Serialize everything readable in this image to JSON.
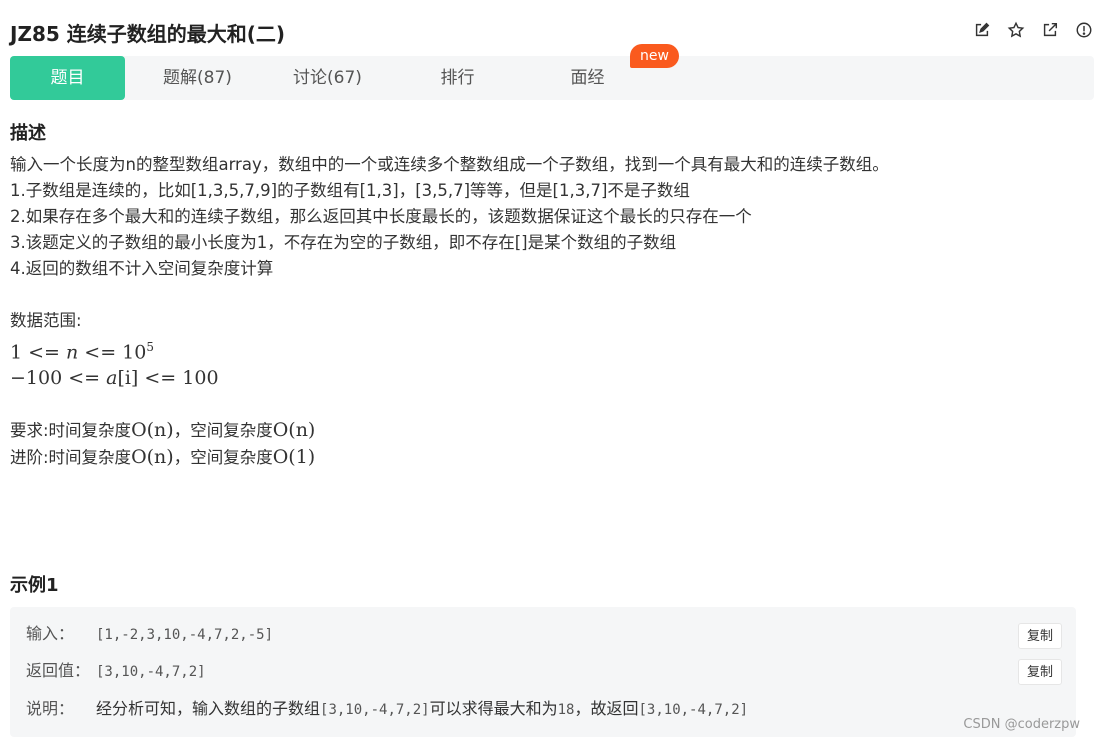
{
  "problem": {
    "title": "JZ85  连续子数组的最大和(二)"
  },
  "header_icons": [
    "edit-icon",
    "star-icon",
    "external-link-icon",
    "info-icon"
  ],
  "tabs": [
    {
      "label": "题目",
      "active": true
    },
    {
      "label": "题解(87)",
      "active": false
    },
    {
      "label": "讨论(67)",
      "active": false
    },
    {
      "label": "排行",
      "active": false
    },
    {
      "label": "面经",
      "active": false
    }
  ],
  "new_badge": "new",
  "description": {
    "heading": "描述",
    "lines": [
      "输入一个长度为n的整型数组array，数组中的一个或连续多个整数组成一个子数组，找到一个具有最大和的连续子数组。",
      "1.子数组是连续的，比如[1,3,5,7,9]的子数组有[1,3]，[3,5,7]等等，但是[1,3,7]不是子数组",
      "2.如果存在多个最大和的连续子数组，那么返回其中长度最长的，该题数据保证这个最长的只存在一个",
      "3.该题定义的子数组的最小长度为1，不存在为空的子数组，即不存在[]是某个数组的子数组",
      "4.返回的数组不计入空间复杂度计算"
    ],
    "range_label": "数据范围:",
    "range_1": {
      "lhs": "1 <= ",
      "var": "n",
      "mid": " <= 10",
      "exp": "5"
    },
    "range_2": {
      "lhs": "−100 <= ",
      "var": "a",
      "idx": "[i]",
      "rhs": " <= 100"
    },
    "req_label": "要求:时间复杂度",
    "req_time": "O(n)",
    "req_sep": "，空间复杂度",
    "req_space": "O(n)",
    "adv_label": "进阶:时间复杂度",
    "adv_time": "O(n)",
    "adv_sep": "，空间复杂度",
    "adv_space": "O(1)"
  },
  "example": {
    "heading": "示例1",
    "input_label": "输入：",
    "input_value": "[1,-2,3,10,-4,7,2,-5]",
    "output_label": "返回值：",
    "output_value": "[3,10,-4,7,2]",
    "note_label": "说明：",
    "note_text_1": "经分析可知，输入数组的子数组",
    "note_code_1": "[3,10,-4,7,2]",
    "note_text_2": "可以求得最大和为",
    "note_code_2": "18",
    "note_text_3": "，故返回",
    "note_code_3": "[3,10,-4,7,2]",
    "copy_label": "复制"
  },
  "watermark": "CSDN @coderzpw",
  "colors": {
    "accent": "#32ca99",
    "badge": "#fa5a1e",
    "panel": "#f5f6f7"
  }
}
